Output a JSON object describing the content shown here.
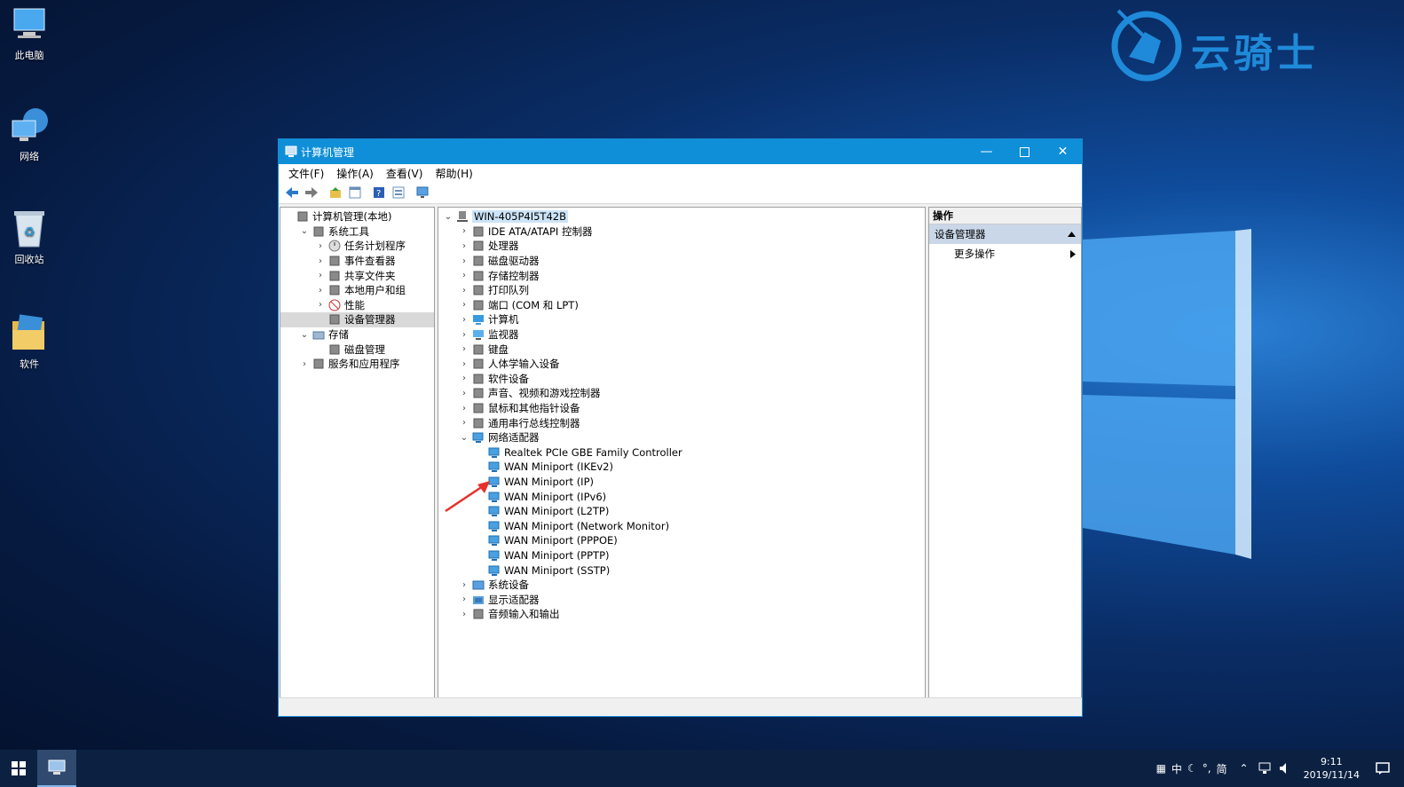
{
  "desktop": {
    "icons": [
      {
        "label": "此电脑",
        "icon": "this-pc-icon"
      },
      {
        "label": "网络",
        "icon": "network-icon"
      },
      {
        "label": "回收站",
        "icon": "recycle-bin-icon"
      },
      {
        "label": "软件",
        "icon": "folder-icon"
      }
    ],
    "logo_text": "云骑士"
  },
  "window": {
    "title": "计算机管理",
    "menu": [
      "文件(F)",
      "操作(A)",
      "查看(V)",
      "帮助(H)"
    ]
  },
  "left_tree": [
    {
      "label": "计算机管理(本地)",
      "level": 0,
      "expander": "",
      "icon": "computer-management-icon"
    },
    {
      "label": "系统工具",
      "level": 1,
      "expander": "open",
      "icon": "tools-icon"
    },
    {
      "label": "任务计划程序",
      "level": 2,
      "expander": "closed",
      "icon": "clock-icon"
    },
    {
      "label": "事件查看器",
      "level": 2,
      "expander": "closed",
      "icon": "event-viewer-icon"
    },
    {
      "label": "共享文件夹",
      "level": 2,
      "expander": "closed",
      "icon": "shared-folder-icon"
    },
    {
      "label": "本地用户和组",
      "level": 2,
      "expander": "closed",
      "icon": "users-icon"
    },
    {
      "label": "性能",
      "level": 2,
      "expander": "closed",
      "icon": "performance-icon"
    },
    {
      "label": "设备管理器",
      "level": 2,
      "expander": "",
      "icon": "device-manager-icon",
      "selected": true
    },
    {
      "label": "存储",
      "level": 1,
      "expander": "open",
      "icon": "storage-icon"
    },
    {
      "label": "磁盘管理",
      "level": 2,
      "expander": "",
      "icon": "disk-management-icon"
    },
    {
      "label": "服务和应用程序",
      "level": 1,
      "expander": "closed",
      "icon": "services-icon"
    }
  ],
  "device_tree": {
    "root": "WIN-405P4I5T42B",
    "items": [
      {
        "label": "IDE ATA/ATAPI 控制器",
        "level": 1,
        "expander": "closed",
        "icon": "ide-controller-icon"
      },
      {
        "label": "处理器",
        "level": 1,
        "expander": "closed",
        "icon": "processor-icon"
      },
      {
        "label": "磁盘驱动器",
        "level": 1,
        "expander": "closed",
        "icon": "disk-drive-icon"
      },
      {
        "label": "存储控制器",
        "level": 1,
        "expander": "closed",
        "icon": "storage-controller-icon"
      },
      {
        "label": "打印队列",
        "level": 1,
        "expander": "closed",
        "icon": "printer-icon"
      },
      {
        "label": "端口 (COM 和 LPT)",
        "level": 1,
        "expander": "closed",
        "icon": "port-icon"
      },
      {
        "label": "计算机",
        "level": 1,
        "expander": "closed",
        "icon": "computer-icon"
      },
      {
        "label": "监视器",
        "level": 1,
        "expander": "closed",
        "icon": "monitor-icon"
      },
      {
        "label": "键盘",
        "level": 1,
        "expander": "closed",
        "icon": "keyboard-icon"
      },
      {
        "label": "人体学输入设备",
        "level": 1,
        "expander": "closed",
        "icon": "hid-icon"
      },
      {
        "label": "软件设备",
        "level": 1,
        "expander": "closed",
        "icon": "software-device-icon"
      },
      {
        "label": "声音、视频和游戏控制器",
        "level": 1,
        "expander": "closed",
        "icon": "sound-icon"
      },
      {
        "label": "鼠标和其他指针设备",
        "level": 1,
        "expander": "closed",
        "icon": "mouse-icon"
      },
      {
        "label": "通用串行总线控制器",
        "level": 1,
        "expander": "closed",
        "icon": "usb-icon"
      },
      {
        "label": "网络适配器",
        "level": 1,
        "expander": "open",
        "icon": "network-adapter-icon"
      },
      {
        "label": "Realtek PCIe GBE Family Controller",
        "level": 2,
        "expander": "",
        "icon": "network-adapter-icon"
      },
      {
        "label": "WAN Miniport (IKEv2)",
        "level": 2,
        "expander": "",
        "icon": "network-adapter-icon"
      },
      {
        "label": "WAN Miniport (IP)",
        "level": 2,
        "expander": "",
        "icon": "network-adapter-icon"
      },
      {
        "label": "WAN Miniport (IPv6)",
        "level": 2,
        "expander": "",
        "icon": "network-adapter-icon"
      },
      {
        "label": "WAN Miniport (L2TP)",
        "level": 2,
        "expander": "",
        "icon": "network-adapter-icon"
      },
      {
        "label": "WAN Miniport (Network Monitor)",
        "level": 2,
        "expander": "",
        "icon": "network-adapter-icon"
      },
      {
        "label": "WAN Miniport (PPPOE)",
        "level": 2,
        "expander": "",
        "icon": "network-adapter-icon"
      },
      {
        "label": "WAN Miniport (PPTP)",
        "level": 2,
        "expander": "",
        "icon": "network-adapter-icon"
      },
      {
        "label": "WAN Miniport (SSTP)",
        "level": 2,
        "expander": "",
        "icon": "network-adapter-icon"
      },
      {
        "label": "系统设备",
        "level": 1,
        "expander": "closed",
        "icon": "system-device-icon"
      },
      {
        "label": "显示适配器",
        "level": 1,
        "expander": "closed",
        "icon": "display-adapter-icon"
      },
      {
        "label": "音频输入和输出",
        "level": 1,
        "expander": "closed",
        "icon": "audio-icon"
      }
    ]
  },
  "actions": {
    "header": "操作",
    "section": "设备管理器",
    "item": "更多操作"
  },
  "taskbar": {
    "ime": [
      "中",
      "简"
    ],
    "time": "9:11",
    "date": "2019/11/14"
  },
  "colors": {
    "title": "#0f8fd8",
    "accent": "#1f8ad9",
    "arrow": "#e8302b"
  }
}
